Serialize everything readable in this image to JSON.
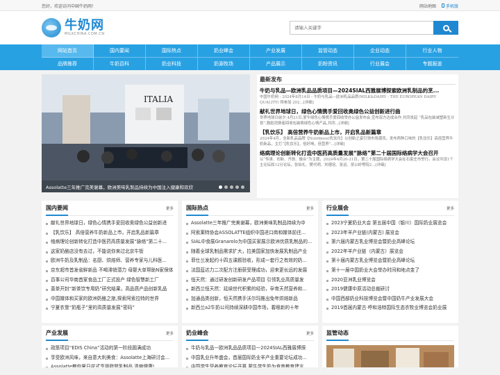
{
  "topbar": {
    "greeting": "您好，欢迎访问中国牛奶网！",
    "sitemap": "网站地图",
    "mobile": "手机版"
  },
  "brand": {
    "name": "牛奶网",
    "domain": "MILKCHINA.COM.CN"
  },
  "search": {
    "placeholder": "请输入关键字",
    "value": ""
  },
  "nav": [
    "网站首页",
    "国内要闻",
    "国际热点",
    "奶业峰会",
    "产业发展",
    "监管动态",
    "企业动态",
    "行业人物",
    "品牌推荐",
    "牛奶百科",
    "奶业科技",
    "奶源牧场",
    "产品展示",
    "奶粉资讯",
    "行业展会",
    "专题报道"
  ],
  "slider": {
    "caption": "Assolatte三年推广完美谢幕，欧洲美味乳制品持续为中国注入健康和欢欣",
    "sign": "ITALIA"
  },
  "latest": {
    "heading": "最新发布",
    "items": [
      {
        "title": "牛奶与乳品—欧洲乳品品质项目—2024SIAL西雅展博探索欧洲乳制品的烹...",
        "desc": "中国牛奶网 - 2024年8月14日 - 牛奶与乳品—欧洲乳品品质(MILK&DAIRY - THE EUROPEAN DAIRY QUALITY) 得参加 202...[详细]"
      },
      {
        "title": "献礼世界地球日，绿色心情携手爱回收奥绿色公益创新进行曲",
        "desc": "世界地球日前夕,4月21日,爱牛绿色心情携手爱回收举办公益发布会,宣布双方达成合作,共同发起 “乳品包装减塑新生计划”,鼓励消费者回收包装换绿色心情产品,共同...[详细]"
      },
      {
        "title": "【乳饮乐】 高倍营养牛奶新品上市，开启乳品新篇章",
        "desc": "2024年4月，全新乳品品牌【Nutriboost乳饮乐】以创新之姿引领市场潮流，发布两种口味的【乳饮乐】高倍营养牛奶新品，主打“【乳饮乐】，倍好喝，倍营养”...[详细]"
      },
      {
        "title": "络病理论创新转化打造中医药高质量发展“脉络”第二十届国际络病学大会召开",
        "desc": "以“传承、创新、开放、融合”为主题，2024年4月20-21日，第二十届国际络病学大会在石家庄市举行。会议共设1个主论坛和12分论坛，张伯礼、樊代明、刘德培、张运、吴以岭等院2...[详细]"
      }
    ]
  },
  "panels": [
    {
      "title": "国内要闻",
      "more": "更多",
      "items": [
        "献礼世界地球日，绿色心情携手爱回收奥绿色公益创新进",
        "【乳饮乐】 高倍营养牛奶新品上市，开启乳品新篇章",
        "络病理论创新转化打造中医药高质量发展“脉络”第二十...",
        "这家奶酪店没有去过，不能说你来过北京牛街",
        "欧洲牛奶及乳制品：名厨、烘焙师、营养专家与儿科医...",
        "京东超市首发省鲜新品 不喝滞销潜力 母婴大单帮助N家保体",
        "百事公司华南首家食品工厂正式投产 绿色智慧新工厂",
        "喜茶开封“新茶饮专用奶”研究结果，高品质产品创新乳品",
        "中国媒体和买家的欧洲奶酪之旅,探索阿索拉特的世界",
        "宁夏农垦“奶瓶子”里的高质量发展“密码”"
      ]
    },
    {
      "title": "国际热点",
      "more": "更多",
      "items": [
        "Assolatte三年推广完美谢幕，欧洲美味乳制品持续为中",
        "阿索莱特协会ASSOLATTE组织中国进口商和媒体前往...",
        "SIAL中食展Granarolo为中国买家展示欧洲优质乳制品的...",
        "随着全球乳制品需求扩大，拉美国家加快发展乳制品产业",
        "菲仕兰发起约十四五课题验收，形成一套行之有效的奶...",
        "法国蓝达力二次配方注册获受理成功，迎来更长远的发展",
        "恒天然：通过研发创新研发产品项目 引领乳业高质量发",
        "新西兰恒天然：延续世代积累的经验，孕育天然营养和...",
        "加通品类创新，恒天然携手沃尔玛推出免年烘焙新品",
        "新西兰a2牛奶公司持续深耕中国市场，着眼新的十年"
      ]
    },
    {
      "title": "行业展会",
      "more": "更多",
      "items": [
        "2023宁夏奶业大会 第五届中国（银川）国际奶业展览会",
        "2023年羊产业链(内蒙古) 展览会",
        "第六届内蒙古乳业博览会暨奶业高峰论坛",
        "2022年羊产业链（内蒙古）展览会",
        "第十届内蒙古乳业博览会暨奶业高峰论坛",
        "第十一届中国奶业大会举办时间和地点变了",
        "2020亚洲乳业博览会",
        "2019健康中原活动总裁研讨",
        "中国西部奶业科技博览会暨中国奶牛产业发展大会",
        "2019首届内蒙古·呼和浩特国际生态农牧业博览会奶业展"
      ]
    }
  ],
  "bottom_panels": [
    {
      "title": "产业发展",
      "more": "更多",
      "items": [
        "政策项目“EDIS China”活动的第一阶段圆满成功",
        "享受欧洲风味，来自意大利美食：Assolatte上海研讨会...",
        "Assolatte教你夏日花式享用欧盟乳制品,清爽健康!"
      ]
    },
    {
      "title": "奶业峰会",
      "more": "更多",
      "items": [
        "牛奶与乳品—欧洲乳品品质项目—2024SIAL西雅展博探",
        "中国乳业升年盛会，首届国际奶业羊产业重要论坛成功...",
        "中国学生营养教育论坛开幕 蒙牛学生奶为食育教育建言..."
      ]
    },
    {
      "title": "监管动态",
      "more": "",
      "items": []
    }
  ]
}
